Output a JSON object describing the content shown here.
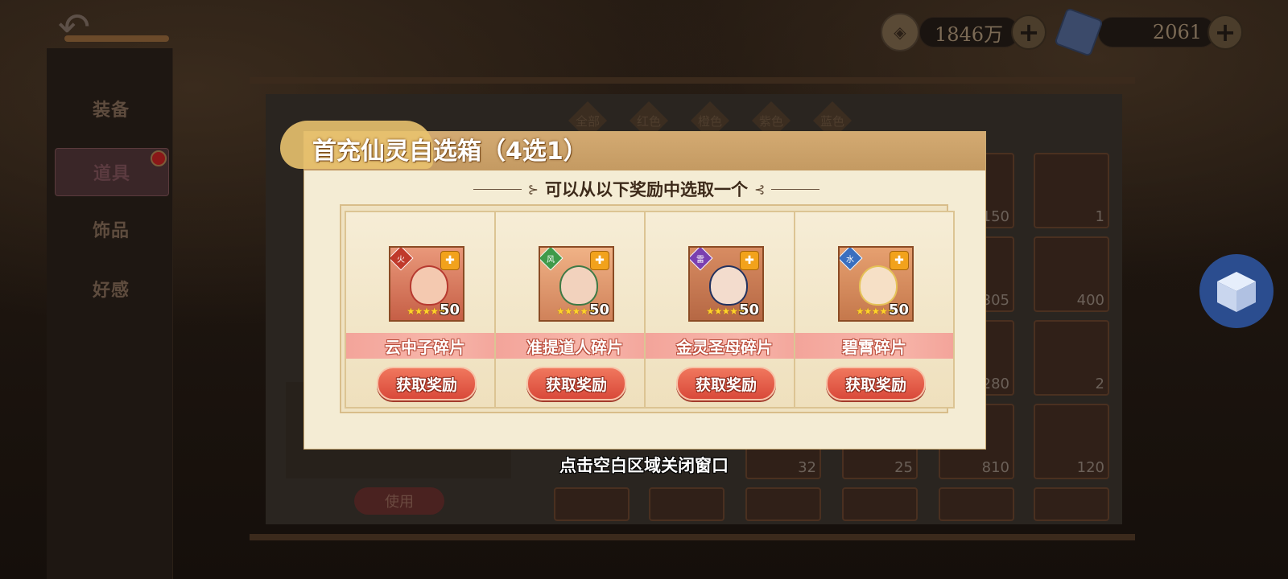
{
  "left_tabs": {
    "items": [
      {
        "label": "装备"
      },
      {
        "label": "道具"
      },
      {
        "label": "饰品"
      },
      {
        "label": "好感"
      }
    ]
  },
  "currency": {
    "copper": {
      "value": "1846万"
    },
    "gem": {
      "value": "2061"
    }
  },
  "filters": [
    "全部",
    "红色",
    "橙色",
    "紫色",
    "蓝色"
  ],
  "inventory": {
    "counts": [
      "150",
      "1",
      "305",
      "400",
      "280",
      "2",
      "32",
      "25",
      "810",
      "120"
    ],
    "use_label": "使用"
  },
  "modal": {
    "title": "首充仙灵自选箱（4选1）",
    "subtitle": "可以从以下奖励中选取一个",
    "cards": [
      {
        "name": "云中子碎片",
        "count": "50",
        "stars": "★★★★★",
        "element": "火",
        "button": "获取奖励",
        "color": "#e56f58"
      },
      {
        "name": "准提道人碎片",
        "count": "50",
        "stars": "★★★★★",
        "element": "风",
        "button": "获取奖励",
        "color": "#7dbd6b"
      },
      {
        "name": "金灵圣母碎片",
        "count": "50",
        "stars": "★★★★★",
        "element": "雷",
        "button": "获取奖励",
        "color": "#6b4aa8"
      },
      {
        "name": "碧霄碎片",
        "count": "50",
        "stars": "★★★★★",
        "element": "水",
        "button": "获取奖励",
        "color": "#5b8fd4"
      }
    ]
  },
  "close_hint": "点击空白区域关闭窗口",
  "colors": {
    "accent": "#d9493a",
    "modal_bg": "#f4ecd4",
    "header": "#c49a62"
  }
}
